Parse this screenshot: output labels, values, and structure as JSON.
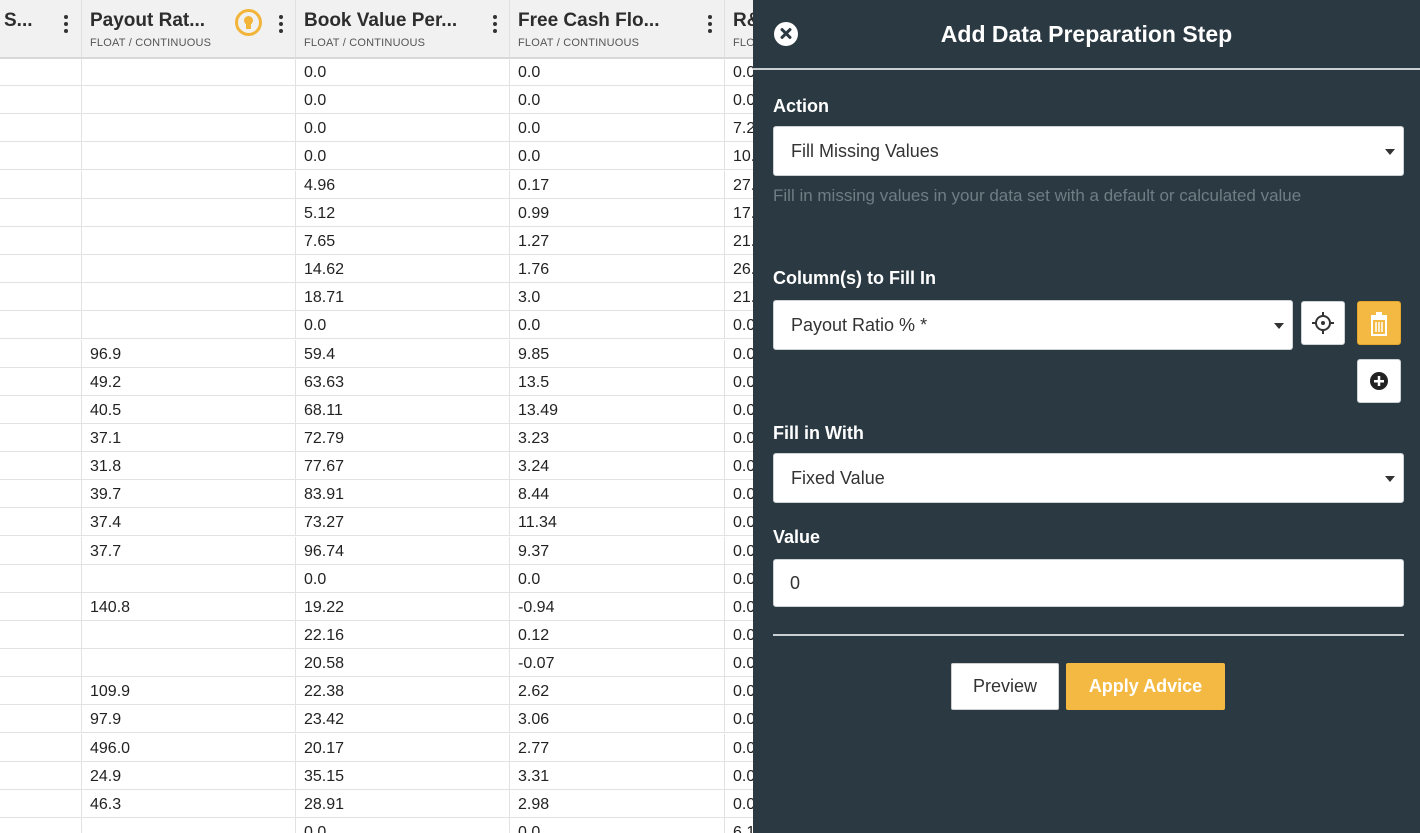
{
  "grid": {
    "columns": [
      {
        "title": "S...",
        "type": ""
      },
      {
        "title": "Payout Rat...",
        "type": "FLOAT / CONTINUOUS"
      },
      {
        "title": "Book Value Per...",
        "type": "FLOAT / CONTINUOUS"
      },
      {
        "title": "Free Cash Flo...",
        "type": "FLOAT / CONTINUOUS"
      },
      {
        "title": "R&",
        "type": "FLO"
      }
    ],
    "rows": [
      [
        "",
        "",
        "0.0",
        "0.0",
        "0.0"
      ],
      [
        "",
        "",
        "0.0",
        "0.0",
        "0.0"
      ],
      [
        "",
        "",
        "0.0",
        "0.0",
        "7.2"
      ],
      [
        "",
        "",
        "0.0",
        "0.0",
        "10."
      ],
      [
        "",
        "",
        "4.96",
        "0.17",
        "27."
      ],
      [
        "",
        "",
        "5.12",
        "0.99",
        "17."
      ],
      [
        "",
        "",
        "7.65",
        "1.27",
        "21."
      ],
      [
        "",
        "",
        "14.62",
        "1.76",
        "26."
      ],
      [
        "",
        "",
        "18.71",
        "3.0",
        "21."
      ],
      [
        "",
        "",
        "0.0",
        "0.0",
        "0.0"
      ],
      [
        "",
        "96.9",
        "59.4",
        "9.85",
        "0.0"
      ],
      [
        "",
        "49.2",
        "63.63",
        "13.5",
        "0.0"
      ],
      [
        "",
        "40.5",
        "68.11",
        "13.49",
        "0.0"
      ],
      [
        "",
        "37.1",
        "72.79",
        "3.23",
        "0.0"
      ],
      [
        "",
        "31.8",
        "77.67",
        "3.24",
        "0.0"
      ],
      [
        "",
        "39.7",
        "83.91",
        "8.44",
        "0.0"
      ],
      [
        "",
        "37.4",
        "73.27",
        "11.34",
        "0.0"
      ],
      [
        "",
        "37.7",
        "96.74",
        "9.37",
        "0.0"
      ],
      [
        "",
        "",
        "0.0",
        "0.0",
        "0.0"
      ],
      [
        "",
        "140.8",
        "19.22",
        "-0.94",
        "0.0"
      ],
      [
        "",
        "",
        "22.16",
        "0.12",
        "0.0"
      ],
      [
        "",
        "",
        "20.58",
        "-0.07",
        "0.0"
      ],
      [
        "",
        "109.9",
        "22.38",
        "2.62",
        "0.0"
      ],
      [
        "",
        "97.9",
        "23.42",
        "3.06",
        "0.0"
      ],
      [
        "",
        "496.0",
        "20.17",
        "2.77",
        "0.0"
      ],
      [
        "",
        "24.9",
        "35.15",
        "3.31",
        "0.0"
      ],
      [
        "",
        "46.3",
        "28.91",
        "2.98",
        "0.0"
      ],
      [
        "",
        "",
        "0.0",
        "0.0",
        "6.1"
      ]
    ]
  },
  "panel": {
    "title": "Add Data Preparation Step",
    "action": {
      "label": "Action",
      "value": "Fill Missing Values",
      "help": "Fill in missing values in your data set with a default or calculated value"
    },
    "columns_to_fill": {
      "label": "Column(s) to Fill In",
      "value": "Payout Ratio % *"
    },
    "fill_with": {
      "label": "Fill in With",
      "value": "Fixed Value"
    },
    "value_field": {
      "label": "Value",
      "value": "0"
    },
    "buttons": {
      "preview": "Preview",
      "apply": "Apply Advice"
    },
    "icons": {
      "close": "close-circle-icon",
      "target": "crosshair-icon",
      "delete": "trash-icon",
      "add": "plus-circle-icon"
    },
    "colors": {
      "panel_bg": "#2b3a42",
      "accent": "#f4b942",
      "help_text": "#6f7d85"
    }
  }
}
